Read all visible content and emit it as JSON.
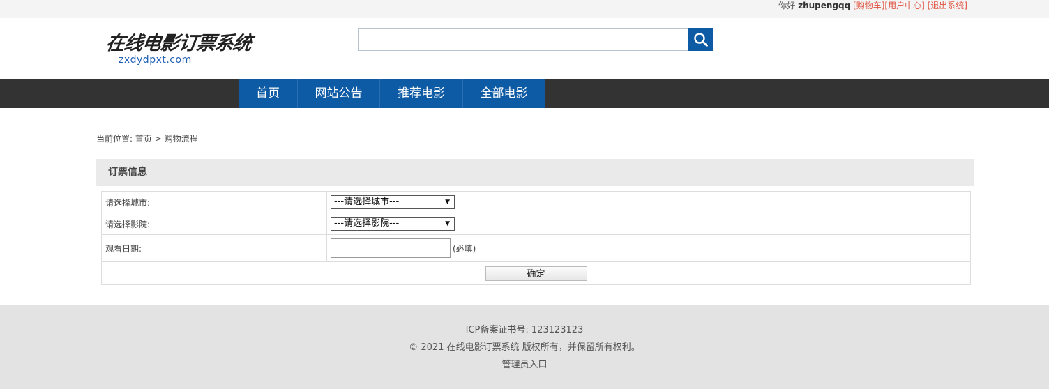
{
  "topbar": {
    "greeting": "你好",
    "username": "zhupengqq",
    "links": [
      "[购物车]",
      "[用户中心]",
      "[退出系统]"
    ]
  },
  "header": {
    "logo_text": "在线电影订票系统",
    "logo_domain": "zxdydpxt.com",
    "search": {
      "value": "",
      "placeholder": ""
    }
  },
  "nav": {
    "items": [
      "首页",
      "网站公告",
      "推荐电影",
      "全部电影"
    ]
  },
  "breadcrumb": {
    "prefix": "当前位置:",
    "home": "首页",
    "separator": ">",
    "current": "购物流程"
  },
  "form": {
    "title": "订票信息",
    "city_label": "请选择城市:",
    "city_selected": "---请选择城市---",
    "cinema_label": "请选择影院:",
    "cinema_selected": "---请选择影院---",
    "date_label": "观看日期:",
    "date_value": "",
    "required_hint": "(必填)",
    "submit_label": "确定"
  },
  "footer": {
    "icp": "ICP备案证书号: 123123123",
    "copyright": "© 2021 在线电影订票系统 版权所有，并保留所有权利。",
    "admin_link": "管理员入口"
  },
  "colors": {
    "brand_blue": "#0e5ba5",
    "nav_dark": "#333333",
    "link_red": "#e0533f"
  }
}
